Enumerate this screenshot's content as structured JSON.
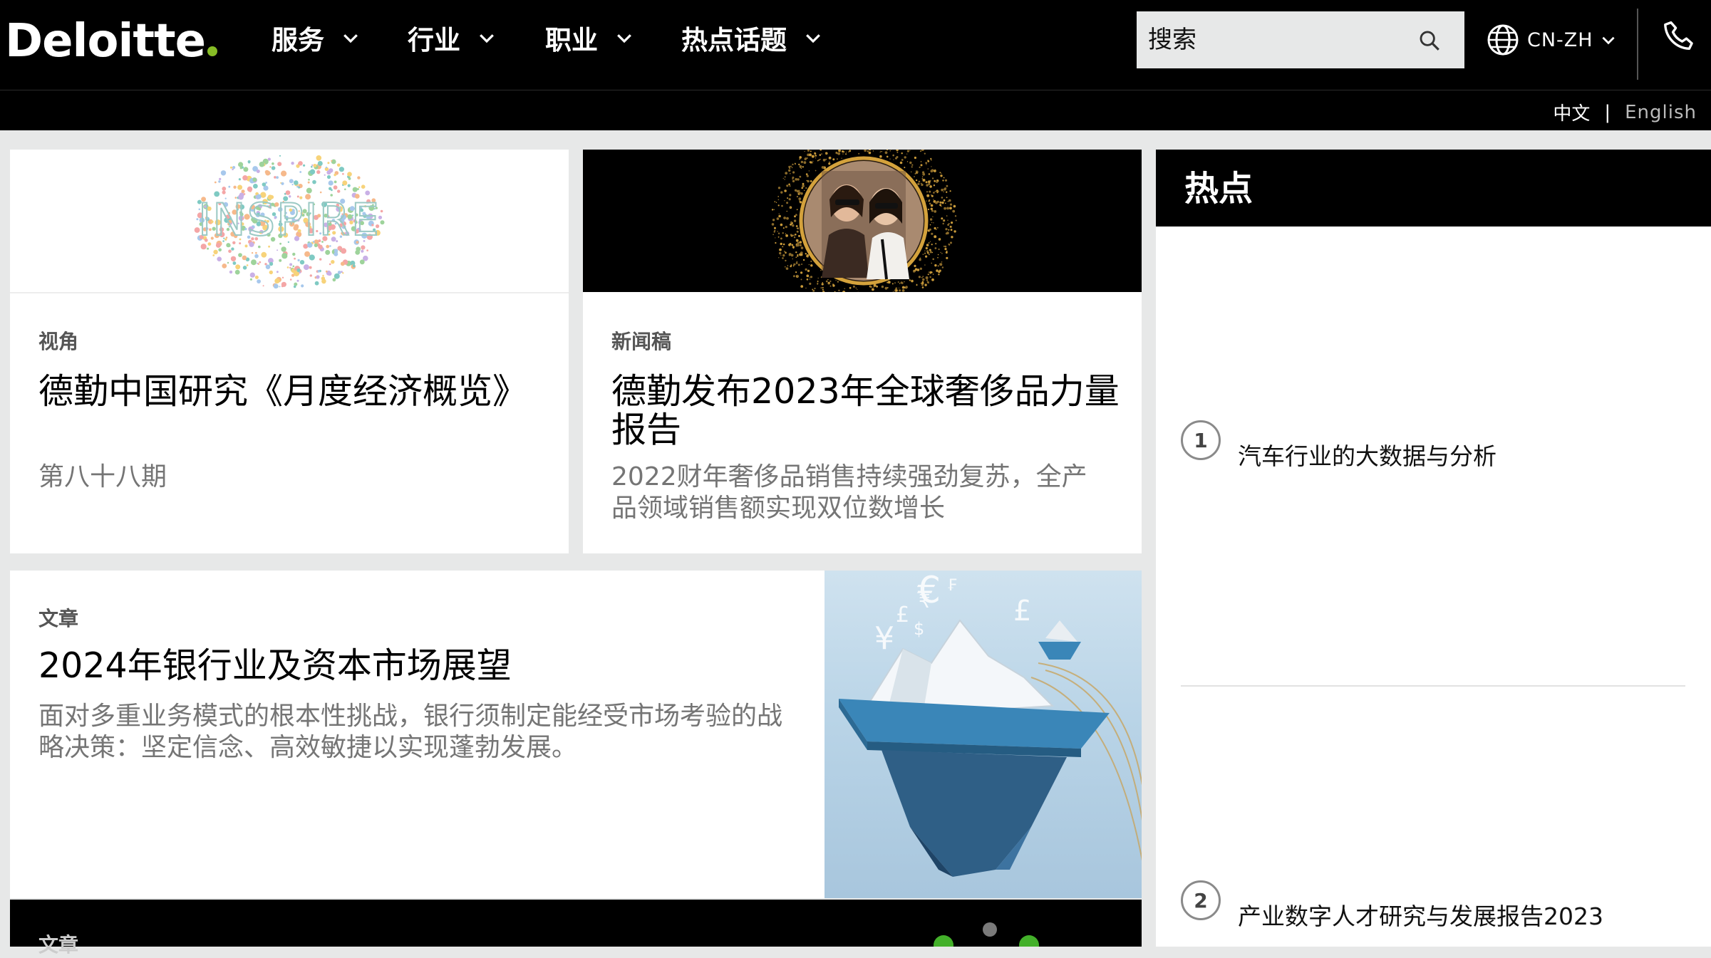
{
  "header": {
    "logo": "Deloitte",
    "nav": [
      {
        "label": "服务"
      },
      {
        "label": "行业"
      },
      {
        "label": "职业"
      },
      {
        "label": "热点话题"
      }
    ],
    "search": {
      "placeholder": "搜索"
    },
    "locale": "CN-ZH"
  },
  "language_bar": {
    "chinese": "中文",
    "separator": "|",
    "english": "English"
  },
  "cards": [
    {
      "category": "视角",
      "title": "德勤中国研究《月度经济概览》",
      "subtitle": "第八十八期",
      "image_text": "INSPIRE"
    },
    {
      "category": "新闻稿",
      "title": "德勤发布2023年全球奢侈品力量报告",
      "subtitle": "2022财年奢侈品销售持续强劲复苏，全产品领域销售额实现双位数增长"
    },
    {
      "category": "文章",
      "title": "2024年银行业及资本市场展望",
      "subtitle": "面对多重业务模式的根本性挑战，银行须制定能经受市场考验的战略决策：坚定信念、高效敏捷以实现蓬勃发展。",
      "image_symbols": [
        "€",
        "₣",
        "£",
        "₹",
        "$",
        "¥",
        "£"
      ]
    },
    {
      "category": "文章"
    }
  ],
  "sidebar": {
    "title": "热点",
    "items": [
      {
        "num": "1",
        "label": "汽车行业的大数据与分析"
      },
      {
        "num": "2",
        "label": "产业数字人才研究与发展报告2023"
      }
    ]
  },
  "colors": {
    "brand_green": "#86bc25",
    "header_bg": "#000000",
    "page_bg": "#e7e8e8"
  }
}
